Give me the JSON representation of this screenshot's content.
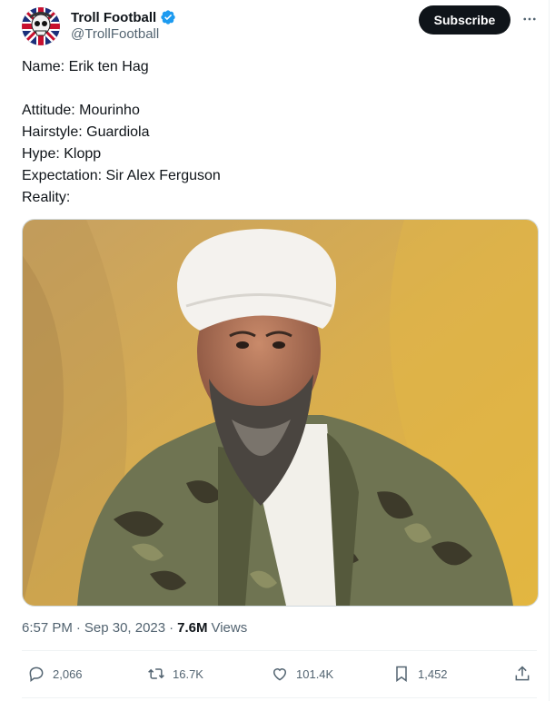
{
  "author": {
    "display_name": "Troll Football",
    "handle": "@TrollFootball",
    "verified": true,
    "avatar_icon": "skull-union-jack-avatar-icon"
  },
  "header": {
    "subscribe_label": "Subscribe",
    "more_icon": "ellipsis-icon"
  },
  "tweet": {
    "lines": [
      "Name: Erik ten Hag",
      "",
      "Attitude: Mourinho",
      "Hairstyle: Guardiola",
      "Hype: Klopp",
      "Expectation: Sir Alex Ferguson",
      "Reality:"
    ]
  },
  "meta": {
    "time": "6:57 PM",
    "sep1": "·",
    "date": "Sep 30, 2023",
    "sep2": "·",
    "views_count": "7.6M",
    "views_label": "Views"
  },
  "actions": {
    "replies": "2,066",
    "reposts": "16.7K",
    "likes": "101.4K",
    "bookmarks": "1,452"
  },
  "colors": {
    "accent": "#1d9bf0",
    "text": "#0f1419",
    "muted": "#536471"
  }
}
